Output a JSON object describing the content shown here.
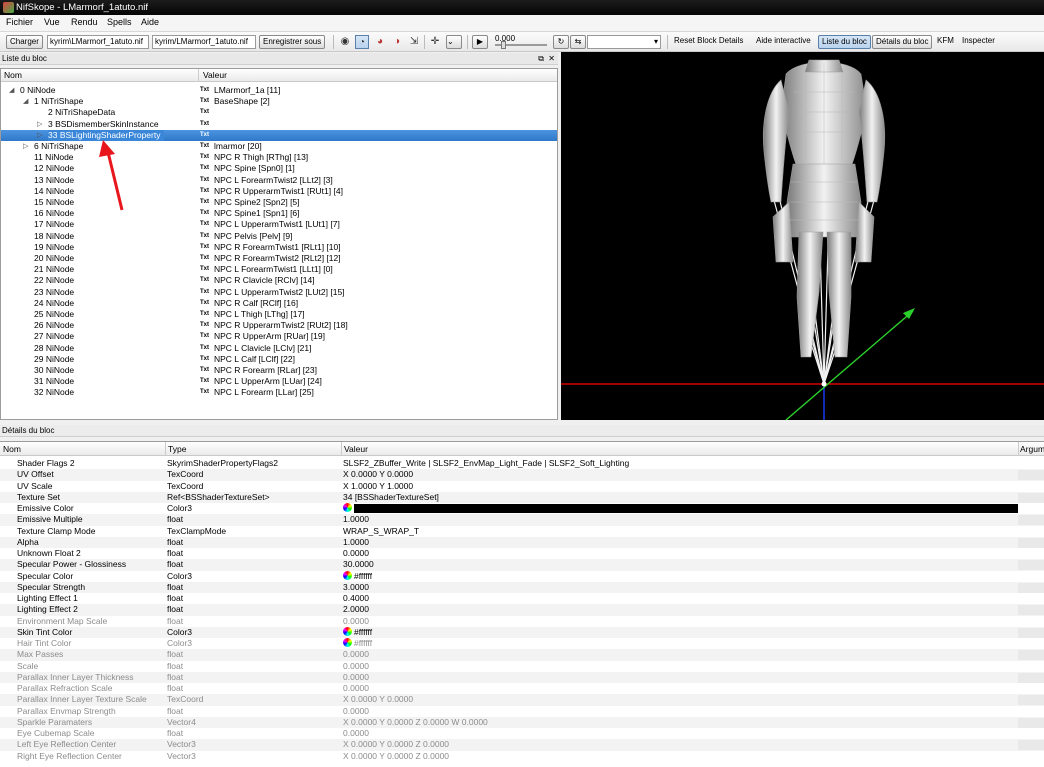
{
  "window": {
    "title": "NifSkope - LMarmorf_1atuto.nif"
  },
  "menu": [
    "Fichier",
    "Vue",
    "Rendu",
    "Spells",
    "Aide"
  ],
  "toolbar": {
    "load_label": "Charger",
    "load_path": "kyrim\\LMarmorf_1atuto.nif",
    "save_path": "kyrim/LMarmorf_1atuto.nif",
    "save_label": "Enregistrer sous",
    "time_value": "0.000",
    "reset_label": "Reset Block Details",
    "help_label": "Aide interactive",
    "block_list_label": "Liste du bloc",
    "block_details_label": "Détails du bloc",
    "kfm_label": "KFM",
    "inspect_label": "Inspecter"
  },
  "block_list": {
    "panel_title": "Liste du bloc",
    "col_name": "Nom",
    "col_value": "Valeur",
    "txt_tag": "Txt",
    "rows": [
      {
        "name": "0 NiNode",
        "value": "LMarmorf_1a [11]",
        "indent": 1,
        "arrow": "expanded"
      },
      {
        "name": "1 NiTriShape",
        "value": "BaseShape [2]",
        "indent": 2,
        "arrow": "expanded"
      },
      {
        "name": "2 NiTriShapeData",
        "value": "",
        "indent": 3,
        "arrow": "none"
      },
      {
        "name": "3 BSDismemberSkinInstance",
        "value": "",
        "indent": 3,
        "arrow": "collapsed"
      },
      {
        "name": "33 BSLightingShaderProperty",
        "value": "",
        "indent": 3,
        "arrow": "collapsed",
        "selected": true
      },
      {
        "name": "6 NiTriShape",
        "value": "lmarmor [20]",
        "indent": 2,
        "arrow": "collapsed"
      },
      {
        "name": "11 NiNode",
        "value": "NPC R Thigh [RThg] [13]",
        "indent": 2,
        "arrow": "none"
      },
      {
        "name": "12 NiNode",
        "value": "NPC Spine [Spn0] [1]",
        "indent": 2,
        "arrow": "none"
      },
      {
        "name": "13 NiNode",
        "value": "NPC L ForearmTwist2 [LLt2] [3]",
        "indent": 2,
        "arrow": "none"
      },
      {
        "name": "14 NiNode",
        "value": "NPC R UpperarmTwist1 [RUt1] [4]",
        "indent": 2,
        "arrow": "none"
      },
      {
        "name": "15 NiNode",
        "value": "NPC Spine2 [Spn2] [5]",
        "indent": 2,
        "arrow": "none"
      },
      {
        "name": "16 NiNode",
        "value": "NPC Spine1 [Spn1] [6]",
        "indent": 2,
        "arrow": "none"
      },
      {
        "name": "17 NiNode",
        "value": "NPC L UpperarmTwist1 [LUt1] [7]",
        "indent": 2,
        "arrow": "none"
      },
      {
        "name": "18 NiNode",
        "value": "NPC Pelvis [Pelv] [9]",
        "indent": 2,
        "arrow": "none"
      },
      {
        "name": "19 NiNode",
        "value": "NPC R ForearmTwist1 [RLt1] [10]",
        "indent": 2,
        "arrow": "none"
      },
      {
        "name": "20 NiNode",
        "value": "NPC R ForearmTwist2 [RLt2] [12]",
        "indent": 2,
        "arrow": "none"
      },
      {
        "name": "21 NiNode",
        "value": "NPC L ForearmTwist1 [LLt1] [0]",
        "indent": 2,
        "arrow": "none"
      },
      {
        "name": "22 NiNode",
        "value": "NPC R Clavicle [RClv] [14]",
        "indent": 2,
        "arrow": "none"
      },
      {
        "name": "23 NiNode",
        "value": "NPC L UpperarmTwist2 [LUt2] [15]",
        "indent": 2,
        "arrow": "none"
      },
      {
        "name": "24 NiNode",
        "value": "NPC R Calf [RClf] [16]",
        "indent": 2,
        "arrow": "none"
      },
      {
        "name": "25 NiNode",
        "value": "NPC L Thigh [LThg] [17]",
        "indent": 2,
        "arrow": "none"
      },
      {
        "name": "26 NiNode",
        "value": "NPC R UpperarmTwist2 [RUt2] [18]",
        "indent": 2,
        "arrow": "none"
      },
      {
        "name": "27 NiNode",
        "value": "NPC R UpperArm [RUar] [19]",
        "indent": 2,
        "arrow": "none"
      },
      {
        "name": "28 NiNode",
        "value": "NPC L Clavicle [LClv] [21]",
        "indent": 2,
        "arrow": "none"
      },
      {
        "name": "29 NiNode",
        "value": "NPC L Calf [LClf] [22]",
        "indent": 2,
        "arrow": "none"
      },
      {
        "name": "30 NiNode",
        "value": "NPC R Forearm [RLar] [23]",
        "indent": 2,
        "arrow": "none"
      },
      {
        "name": "31 NiNode",
        "value": "NPC L UpperArm [LUar] [24]",
        "indent": 2,
        "arrow": "none"
      },
      {
        "name": "32 NiNode",
        "value": "NPC L Forearm [LLar] [25]",
        "indent": 2,
        "arrow": "none"
      }
    ]
  },
  "block_details": {
    "panel_title": "Détails du bloc",
    "col_name": "Nom",
    "col_type": "Type",
    "col_value": "Valeur",
    "col_arg": "Argum",
    "rows": [
      {
        "name": "Shader Flags 2",
        "type": "SkyrimShaderPropertyFlags2",
        "value": "SLSF2_ZBuffer_Write | SLSF2_EnvMap_Light_Fade | SLSF2_Soft_Lighting"
      },
      {
        "name": "UV Offset",
        "type": "TexCoord",
        "value": "X 0.0000 Y 0.0000"
      },
      {
        "name": "UV Scale",
        "type": "TexCoord",
        "value": "X 1.0000 Y 1.0000"
      },
      {
        "name": "Texture Set",
        "type": "Ref<BSShaderTextureSet>",
        "value": "34 [BSShaderTextureSet]"
      },
      {
        "name": "Emissive Color",
        "type": "Color3",
        "value": "",
        "swatch": "#000000"
      },
      {
        "name": "Emissive Multiple",
        "type": "float",
        "value": "1.0000"
      },
      {
        "name": "Texture Clamp Mode",
        "type": "TexClampMode",
        "value": "WRAP_S_WRAP_T"
      },
      {
        "name": "Alpha",
        "type": "float",
        "value": "1.0000"
      },
      {
        "name": "Unknown Float 2",
        "type": "float",
        "value": "0.0000"
      },
      {
        "name": "Specular Power - Glossiness",
        "type": "float",
        "value": "30.0000"
      },
      {
        "name": "Specular Color",
        "type": "Color3",
        "value": "#ffffff",
        "wheel": true
      },
      {
        "name": "Specular Strength",
        "type": "float",
        "value": "3.0000"
      },
      {
        "name": "Lighting Effect 1",
        "type": "float",
        "value": "0.4000"
      },
      {
        "name": "Lighting Effect 2",
        "type": "float",
        "value": "2.0000"
      },
      {
        "name": "Environment Map Scale",
        "type": "float",
        "value": "0.0000",
        "grey": true
      },
      {
        "name": "Skin Tint Color",
        "type": "Color3",
        "value": "#ffffff",
        "wheel": true
      },
      {
        "name": "Hair Tint Color",
        "type": "Color3",
        "value": "#ffffff",
        "wheel": true,
        "grey": true
      },
      {
        "name": "Max Passes",
        "type": "float",
        "value": "0.0000",
        "grey": true
      },
      {
        "name": "Scale",
        "type": "float",
        "value": "0.0000",
        "grey": true
      },
      {
        "name": "Parallax Inner Layer Thickness",
        "type": "float",
        "value": "0.0000",
        "grey": true
      },
      {
        "name": "Parallax Refraction Scale",
        "type": "float",
        "value": "0.0000",
        "grey": true
      },
      {
        "name": "Parallax Inner Layer Texture Scale",
        "type": "TexCoord",
        "value": "X 0.0000 Y 0.0000",
        "grey": true
      },
      {
        "name": "Parallax Envmap Strength",
        "type": "float",
        "value": "0.0000",
        "grey": true
      },
      {
        "name": "Sparkle Paramaters",
        "type": "Vector4",
        "value": "X 0.0000 Y 0.0000 Z 0.0000 W 0.0000",
        "grey": true
      },
      {
        "name": "Eye Cubemap Scale",
        "type": "float",
        "value": "0.0000",
        "grey": true
      },
      {
        "name": "Left Eye Reflection Center",
        "type": "Vector3",
        "value": "X 0.0000 Y 0.0000 Z 0.0000",
        "grey": true
      },
      {
        "name": "Right Eye Reflection Center",
        "type": "Vector3",
        "value": "X 0.0000 Y 0.0000 Z 0.0000",
        "grey": true
      }
    ]
  },
  "colors": {
    "selection": "#3a86d8",
    "annotation_arrow": "#e8161d",
    "axis_red": "#ff0000",
    "axis_green": "#2bd12b",
    "axis_blue": "#1c3cff"
  }
}
